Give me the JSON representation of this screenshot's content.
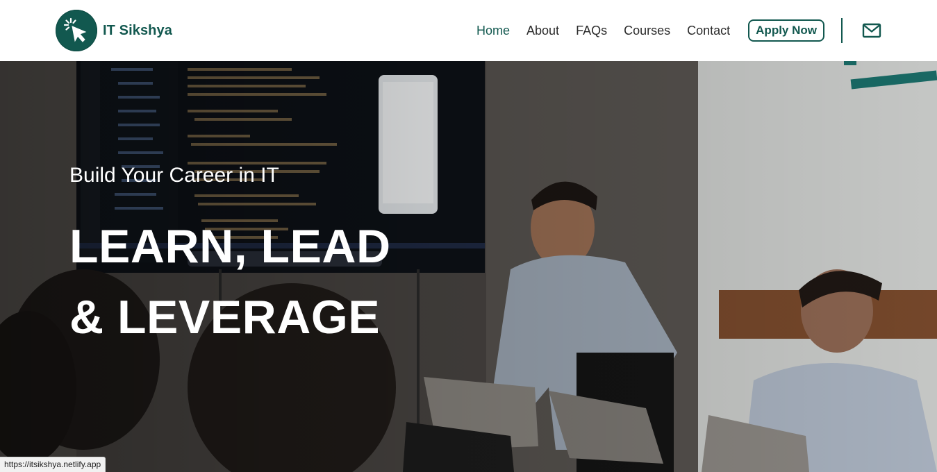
{
  "brand": {
    "name": "IT Sikshya",
    "logo_icon": "cursor-click-icon"
  },
  "nav": {
    "items": [
      {
        "label": "Home",
        "active": true
      },
      {
        "label": "About",
        "active": false
      },
      {
        "label": "FAQs",
        "active": false
      },
      {
        "label": "Courses",
        "active": false
      },
      {
        "label": "Contact",
        "active": false
      }
    ],
    "apply_label": "Apply Now",
    "mail_icon": "mail-icon"
  },
  "hero": {
    "subtitle": "Build Your Career in IT",
    "title_line1": "LEARN, LEAD",
    "title_line2": "& LEVERAGE"
  },
  "status_bar": {
    "url": "https://itsikshya.netlify.app"
  },
  "colors": {
    "brand": "#12584f",
    "text": "#2b2b2b",
    "hero_text": "#ffffff"
  }
}
